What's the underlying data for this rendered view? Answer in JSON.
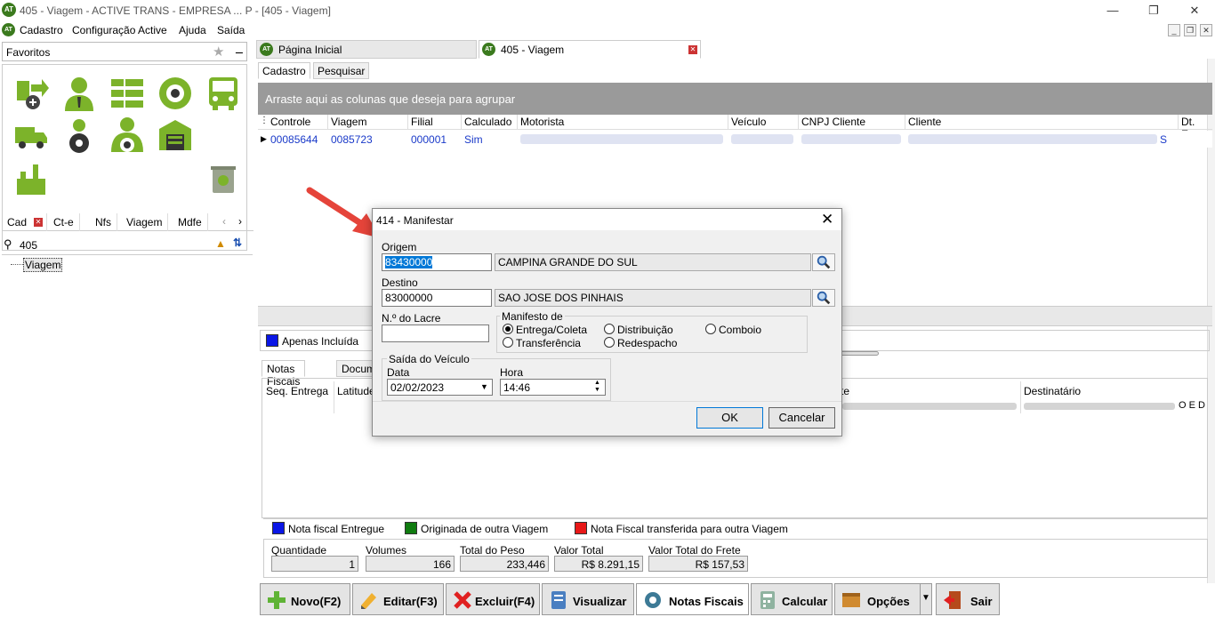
{
  "window": {
    "title": "405 - Viagem - ACTIVE TRANS - EMPRESA ... P - [405 - Viagem]",
    "logo": "AT"
  },
  "menu": [
    "Cadastro",
    "Configuração Active",
    "Ajuda",
    "Saída"
  ],
  "left_panel": {
    "favorites_label": "Favoritos",
    "tabs": [
      "Cad",
      "Ct-e",
      "Nfs",
      "Viagem",
      "Mdfe"
    ],
    "search_value": "405",
    "tree_item": "Viagem"
  },
  "doc_tabs": [
    {
      "label": "Página Inicial"
    },
    {
      "label": "405 - Viagem"
    }
  ],
  "sub_tabs": [
    "Cadastro",
    "Pesquisar"
  ],
  "group_bar": "Arraste aqui as colunas que deseja para agrupar",
  "grid": {
    "columns": [
      "Controle",
      "Viagem",
      "Filial",
      "Calculado",
      "Motorista",
      "Veículo",
      "CNPJ Cliente",
      "Cliente",
      "Dt. Em"
    ],
    "row": {
      "controle": "00085644",
      "viagem": "0085723",
      "filial": "000001",
      "calculado": "Sim",
      "cliente_end": "S"
    }
  },
  "checkbox_apenas": "Apenas Incluída",
  "lower_tabs": [
    "Notas Fiscais",
    "Docum"
  ],
  "lower_grid_cols": [
    "Seq. Entrega",
    "Latitude",
    "te",
    "Destinatário"
  ],
  "lower_grid_tail": "O E D",
  "legend": [
    {
      "label": "Nota fiscal Entregue",
      "color": "#0a16e6"
    },
    {
      "label": "Originada de outra Viagem",
      "color": "#107c10"
    },
    {
      "label": "Nota Fiscal transferida para outra Viagem",
      "color": "#e81818"
    }
  ],
  "totals": [
    {
      "label": "Quantidade",
      "value": "1"
    },
    {
      "label": "Volumes",
      "value": "166"
    },
    {
      "label": "Total do Peso",
      "value": "233,446"
    },
    {
      "label": "Valor Total",
      "value": "R$ 8.291,15"
    },
    {
      "label": "Valor Total do Frete",
      "value": "R$ 157,53"
    }
  ],
  "toolbar": [
    "Novo(F2)",
    "Editar(F3)",
    "Excluir(F4)",
    "Visualizar",
    "Notas Fiscais",
    "Calcular",
    "Opções",
    "Sair"
  ],
  "dialog": {
    "title": "414 - Manifestar",
    "origem_label": "Origem",
    "origem_code": "83430000",
    "origem_city": "CAMPINA GRANDE DO SUL",
    "destino_label": "Destino",
    "destino_code": "83000000",
    "destino_city": "SAO JOSE DOS PINHAIS",
    "lacre_label": "N.º do Lacre",
    "lacre_value": "",
    "manifesto_label": "Manifesto de",
    "options": [
      "Entrega/Coleta",
      "Distribuição",
      "Comboio",
      "Transferência",
      "Redespacho"
    ],
    "selected": "Entrega/Coleta",
    "saida_label": "Saída do Veículo",
    "data_label": "Data",
    "data_value": "02/02/2023",
    "hora_label": "Hora",
    "hora_value": "14:46",
    "ok": "OK",
    "cancel": "Cancelar"
  }
}
